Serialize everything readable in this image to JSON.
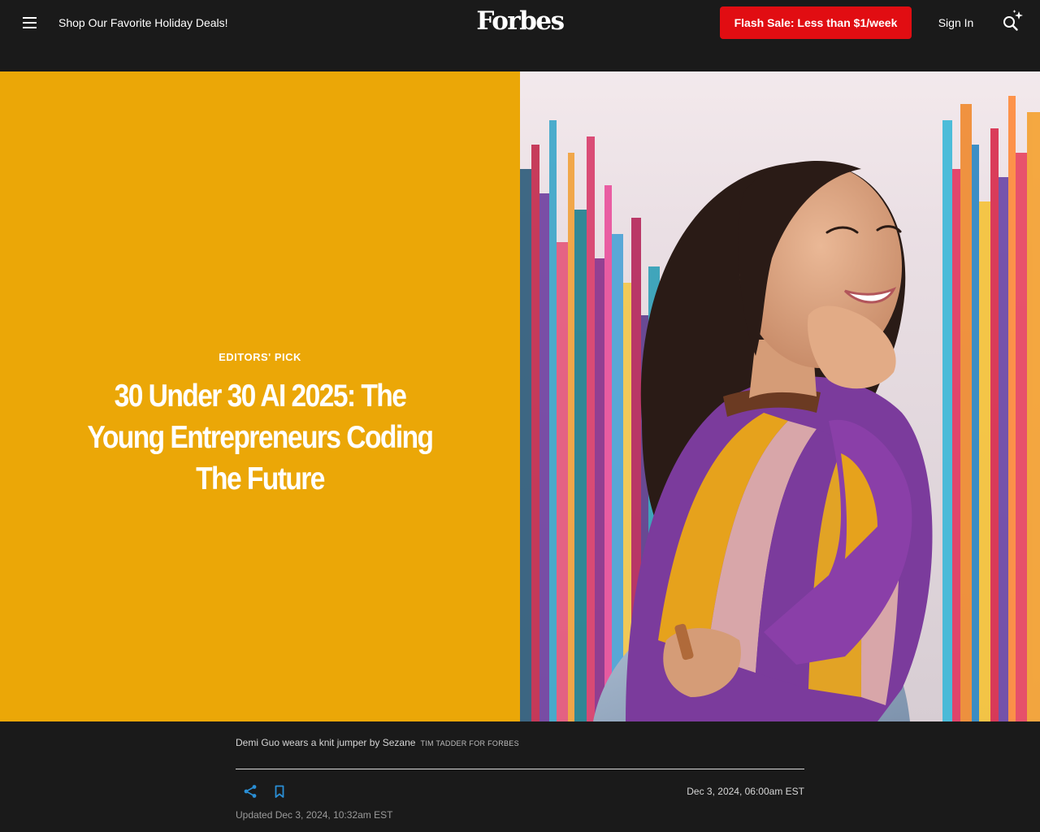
{
  "header": {
    "promo_text": "Shop Our Favorite Holiday Deals!",
    "logo_text": "Forbes",
    "flash_sale_label": "Flash Sale: Less than $1/week",
    "sign_in_label": "Sign In",
    "menu_icon": "hamburger-menu-icon",
    "search_icon": "search-sparkle-icon"
  },
  "hero": {
    "kicker": "EDITORS' PICK",
    "headline": "30 Under 30 AI 2025: The Young Entrepreneurs Coding The Future",
    "image_alt": "Demi Guo wears a knit jumper by Sezane"
  },
  "caption": {
    "text": "Demi Guo wears a knit jumper by Sezane",
    "credit": "TIM TADDER FOR FORBES"
  },
  "meta": {
    "published": "Dec 3, 2024, 06:00am EST",
    "updated": "Updated Dec 3, 2024, 10:32am EST",
    "share_icon": "share-icon",
    "bookmark_icon": "bookmark-icon"
  },
  "colors": {
    "header_bg": "#1a1a1a",
    "hero_bg": "#eba707",
    "flash_sale_bg": "#e10d12",
    "icon_accent": "#2a8fd6"
  }
}
